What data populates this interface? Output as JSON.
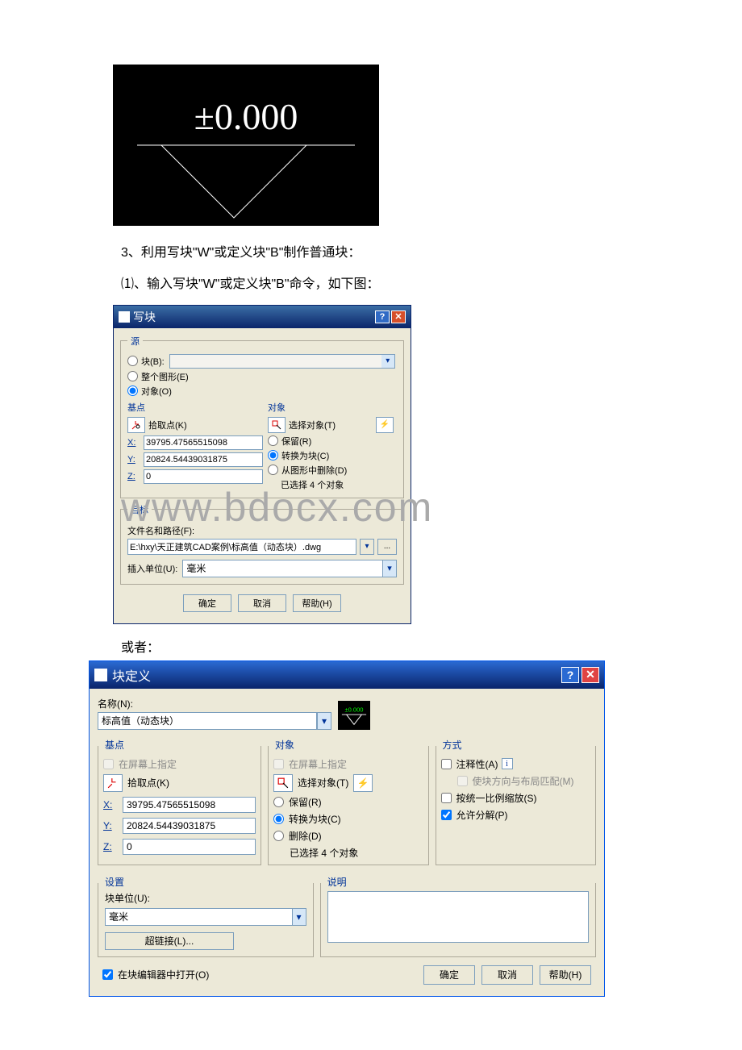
{
  "cad_display": "±0.000",
  "doc": {
    "line1": "3、利用写块\"W\"或定义块\"B\"制作普通块：",
    "line2": "⑴、输入写块\"W\"或定义块\"B\"命令，如下图：",
    "or": "或者："
  },
  "watermark": "www.bdocx.com",
  "wblock": {
    "title": "写块",
    "source_legend": "源",
    "radio_block": "块(B):",
    "radio_entire": "整个图形(E)",
    "radio_objects": "对象(O)",
    "basepoint_legend": "基点",
    "pick_point": "拾取点(K)",
    "x_label": "X:",
    "y_label": "Y:",
    "z_label": "Z:",
    "x_val": "39795.47565515098",
    "y_val": "20824.54439031875",
    "z_val": "0",
    "objects_legend": "对象",
    "select_objects": "选择对象(T)",
    "retain": "保留(R)",
    "convert": "转换为块(C)",
    "delete": "从图形中删除(D)",
    "selected_count": "已选择 4 个对象",
    "dest_legend": "目标",
    "filepath_label": "文件名和路径(F):",
    "filepath": "E:\\hxy\\天正建筑CAD案例\\标高值（动态块）.dwg",
    "insert_units_label": "插入单位(U):",
    "insert_units": "毫米",
    "ok": "确定",
    "cancel": "取消",
    "help": "帮助(H)"
  },
  "bdef": {
    "title": "块定义",
    "name_label": "名称(N):",
    "name_value": "标高值（动态块）",
    "basepoint_legend": "基点",
    "on_screen": "在屏幕上指定",
    "pick_point": "拾取点(K)",
    "x_label": "X:",
    "y_label": "Y:",
    "z_label": "Z:",
    "x_val": "39795.47565515098",
    "y_val": "20824.54439031875",
    "z_val": "0",
    "objects_legend": "对象",
    "on_screen2": "在屏幕上指定",
    "select_objects": "选择对象(T)",
    "retain": "保留(R)",
    "convert": "转换为块(C)",
    "delete": "删除(D)",
    "selected_count": "已选择 4 个对象",
    "mode_legend": "方式",
    "annotative": "注释性(A)",
    "match_layout": "使块方向与布局匹配(M)",
    "uniform_scale": "按统一比例缩放(S)",
    "allow_explode": "允许分解(P)",
    "settings_legend": "设置",
    "block_unit_label": "块单位(U):",
    "block_unit": "毫米",
    "hyperlink": "超链接(L)...",
    "desc_legend": "说明",
    "open_in_editor": "在块编辑器中打开(O)",
    "ok": "确定",
    "cancel": "取消",
    "help": "帮助(H)"
  }
}
